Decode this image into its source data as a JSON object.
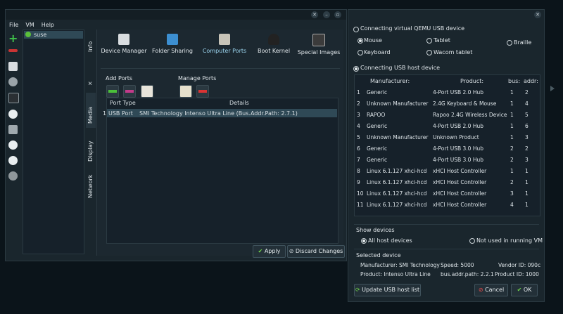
{
  "menu": [
    "File",
    "VM",
    "Help"
  ],
  "vm_list": {
    "selected": "suse"
  },
  "side_tabs": [
    "Info",
    "Media",
    "Display",
    "Network"
  ],
  "content_tabs": [
    "Device Manager",
    "Folder Sharing",
    "Computer Ports",
    "Boot Kernel",
    "Special Images"
  ],
  "add_ports_label": "Add Ports",
  "manage_ports_label": "Manage Ports",
  "port_table": {
    "headers": [
      "Port Type",
      "Details"
    ],
    "rows": [
      {
        "num": "1",
        "type": "USB Port",
        "details": "SMI Technology Intenso Ultra Line (Bus.Addr.Path: 2.7.1)"
      }
    ]
  },
  "buttons": {
    "apply": "Apply",
    "discard": "Discard Changes"
  },
  "usb": {
    "virtual_label": "Connecting virtual QEMU USB device",
    "virtual_options": [
      "Mouse",
      "Tablet",
      "Braille",
      "Keyboard",
      "Wacom tablet"
    ],
    "host_label": "Connecting USB host device",
    "headers": [
      "Manufacturer:",
      "Product:",
      "bus:",
      "addr:"
    ],
    "rows": [
      [
        "1",
        "Generic",
        "4-Port USB 2.0 Hub",
        "1",
        "2"
      ],
      [
        "2",
        "Unknown Manufacturer",
        "2.4G Keyboard & Mouse",
        "1",
        "4"
      ],
      [
        "3",
        "RAPOO",
        "Rapoo 2.4G Wireless Device",
        "1",
        "5"
      ],
      [
        "4",
        "Generic",
        "4-Port USB 2.0 Hub",
        "1",
        "6"
      ],
      [
        "5",
        "Unknown Manufacturer",
        "Unknown Product",
        "1",
        "3"
      ],
      [
        "6",
        "Generic",
        "4-Port USB 3.0 Hub",
        "2",
        "2"
      ],
      [
        "7",
        "Generic",
        "4-Port USB 3.0 Hub",
        "2",
        "3"
      ],
      [
        "8",
        "Linux 6.1.127 xhci-hcd",
        "xHCI Host Controller",
        "1",
        "1"
      ],
      [
        "9",
        "Linux 6.1.127 xhci-hcd",
        "xHCI Host Controller",
        "2",
        "1"
      ],
      [
        "10",
        "Linux 6.1.127 xhci-hcd",
        "xHCI Host Controller",
        "3",
        "1"
      ],
      [
        "11",
        "Linux 6.1.127 xhci-hcd",
        "xHCI Host Controller",
        "4",
        "1"
      ]
    ],
    "show_devices_label": "Show devices",
    "show_all": "All host devices",
    "show_unused": "Not used in running VM",
    "selected_label": "Selected device",
    "manufacturer": "Manufacturer: SMI Technology",
    "speed": "Speed: 5000",
    "vendor": "Vendor ID: 090c",
    "product": "Product: Intenso Ultra Line",
    "bus_addr": "bus.addr.path: 2.2.1",
    "product_id": "Product ID: 1000",
    "update_button": "Update USB host list",
    "cancel_button": "Cancel",
    "ok_button": "OK"
  },
  "colors": {
    "accent": "#9ad3ec",
    "selection": "#2f4956",
    "background": "#0b141a"
  }
}
